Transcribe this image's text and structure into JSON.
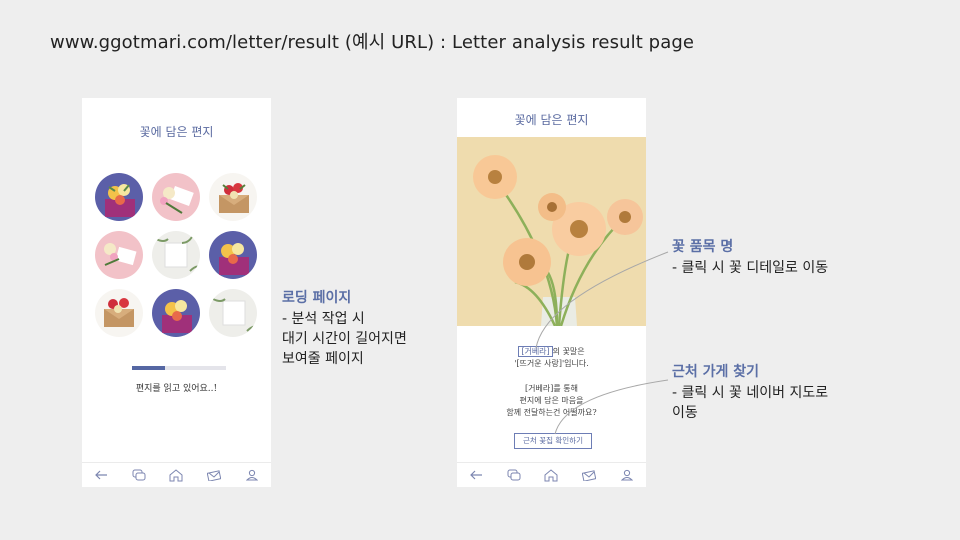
{
  "slide": {
    "title": "www.ggotmari.com/letter/result (예시 URL) : Letter analysis result page"
  },
  "app": {
    "title": "꽃에 담은 편지"
  },
  "loading_screen": {
    "progress": 0.35,
    "loading_text": "편지를 읽고 있어요..!"
  },
  "result_screen": {
    "flower_name": "[거베라]",
    "meaning_line1_suffix": "의 꽃말은",
    "meaning_line2": "'[뜨거운 사랑]'입니다.",
    "question_line1": "[거베라]를 통해",
    "question_line2": "편지에 담은 마음을",
    "question_line3": "함께 전달하는건 어떨까요?",
    "store_button": "근처 꽃집 확인하기"
  },
  "nav": {
    "items": [
      "back-arrow-icon",
      "chat-icon",
      "home-icon",
      "letter-icon",
      "user-icon"
    ]
  },
  "annotations": {
    "loading": {
      "title": "로딩 페이지",
      "line1": "- 분석 작업 시",
      "line2": "대기 시간이 길어지면",
      "line3": "보여줄 페이지"
    },
    "flower": {
      "title": "꽃 품목 명",
      "line1": "- 클릭 시 꽃 디테일로 이동"
    },
    "store": {
      "title": "근처 가게 찾기",
      "line1": "- 클릭 시 꽃 네이버 지도로",
      "line2": "이동"
    }
  },
  "colors": {
    "accent": "#5567a3",
    "annotation": "#5b6fa6",
    "background": "#eeeeee"
  }
}
